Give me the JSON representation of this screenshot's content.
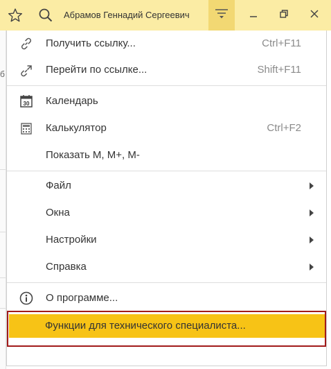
{
  "titlebar": {
    "user_name": "Абрамов Геннадий Сергеевич",
    "icons": [
      "star-icon",
      "search-icon",
      "hamburger-menu-icon",
      "minimize-icon",
      "restore-icon",
      "close-icon"
    ],
    "colors": {
      "bar": "#fbeca4",
      "menu_button": "#f2d873"
    }
  },
  "background": {
    "edge_glyph": "б"
  },
  "menu": {
    "items": [
      {
        "label": "Получить ссылку...",
        "shortcut": "Ctrl+F11",
        "icon": "link-icon"
      },
      {
        "label": "Перейти по ссылке...",
        "shortcut": "Shift+F11",
        "icon": "go-to-link-icon"
      },
      {
        "label": "Календарь",
        "shortcut": "",
        "icon": "calendar-icon",
        "icon_text": "30"
      },
      {
        "label": "Калькулятор",
        "shortcut": "Ctrl+F2",
        "icon": "calculator-icon"
      },
      {
        "label": "Показать М, М+, М-",
        "shortcut": ""
      },
      {
        "label": "Файл",
        "submenu": true
      },
      {
        "label": "Окна",
        "submenu": true
      },
      {
        "label": "Настройки",
        "submenu": true
      },
      {
        "label": "Справка",
        "submenu": true
      },
      {
        "label": "О программе...",
        "icon": "info-icon"
      },
      {
        "label": "Функции для технического специалиста...",
        "highlighted": true
      }
    ],
    "colors": {
      "highlight": "#f7c316",
      "highlight_frame": "#a11a1a"
    }
  }
}
